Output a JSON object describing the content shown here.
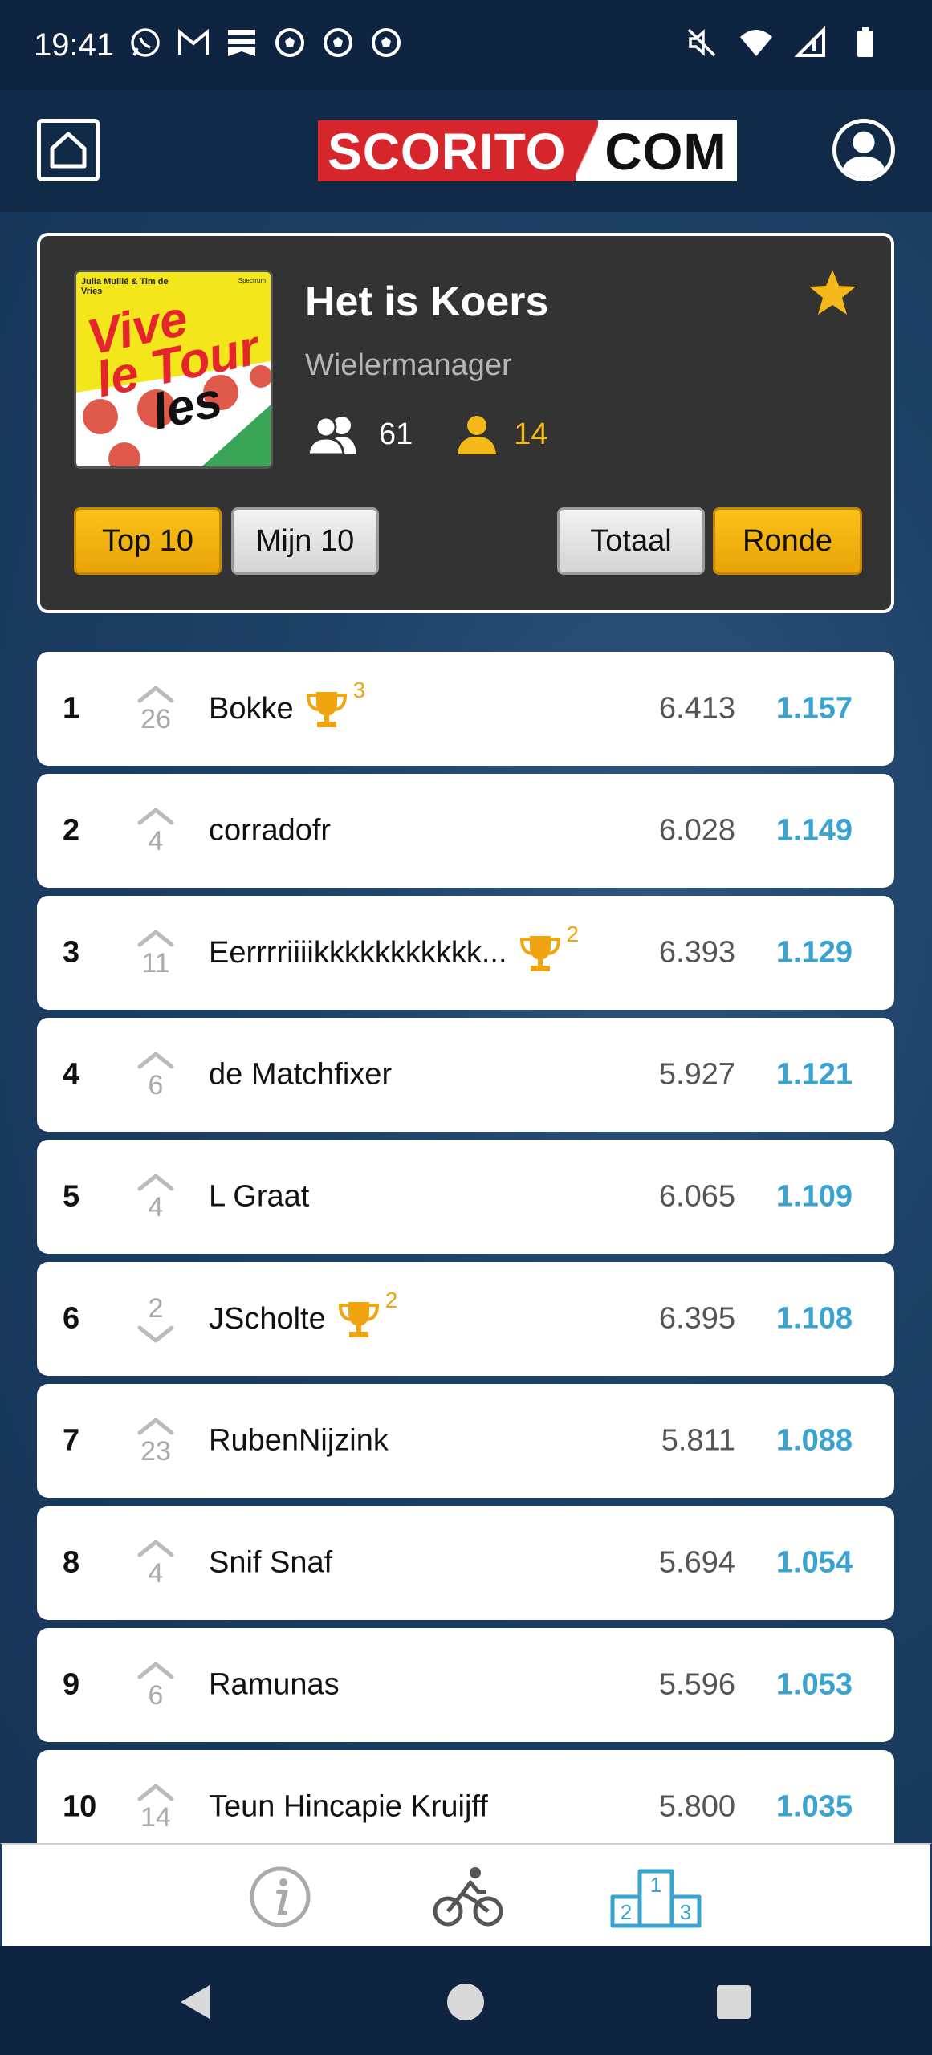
{
  "status_bar": {
    "time": "19:41",
    "left_icons": [
      "whatsapp-icon",
      "gmail-icon",
      "news-icon",
      "soccer-ball-icon",
      "soccer-ball-icon",
      "soccer-ball-icon"
    ],
    "right_icons": [
      "mute-icon",
      "wifi-icon",
      "signal-icon",
      "battery-icon"
    ]
  },
  "header": {
    "logo_left": "SCORITO",
    "logo_right": "COM"
  },
  "league": {
    "cover_author": "Julia Mullié & Tim de Vries",
    "cover_publisher": "Spectrum",
    "cover_title_line1": "Vive",
    "cover_title_line2": "le Tour",
    "cover_title_line3": "les",
    "title": "Het is Koers",
    "type": "Wielermanager",
    "members_count": "61",
    "my_count": "14"
  },
  "filters": {
    "top10": "Top 10",
    "mijn10": "Mijn 10",
    "totaal": "Totaal",
    "ronde": "Ronde"
  },
  "rows": [
    {
      "pos": "1",
      "dir": "up",
      "move": "26",
      "name": "Bokke",
      "trophies": "3",
      "total": "6.413",
      "round": "1.157"
    },
    {
      "pos": "2",
      "dir": "up",
      "move": "4",
      "name": "corradofr",
      "trophies": "",
      "total": "6.028",
      "round": "1.149"
    },
    {
      "pos": "3",
      "dir": "up",
      "move": "11",
      "name": "Eerrrriiiikkkkkkkkkkk...",
      "trophies": "2",
      "total": "6.393",
      "round": "1.129"
    },
    {
      "pos": "4",
      "dir": "up",
      "move": "6",
      "name": "de Matchfixer",
      "trophies": "",
      "total": "5.927",
      "round": "1.121"
    },
    {
      "pos": "5",
      "dir": "up",
      "move": "4",
      "name": "L Graat",
      "trophies": "",
      "total": "6.065",
      "round": "1.109"
    },
    {
      "pos": "6",
      "dir": "down",
      "move": "2",
      "name": "JScholte",
      "trophies": "2",
      "total": "6.395",
      "round": "1.108"
    },
    {
      "pos": "7",
      "dir": "up",
      "move": "23",
      "name": "RubenNijzink",
      "trophies": "",
      "total": "5.811",
      "round": "1.088"
    },
    {
      "pos": "8",
      "dir": "up",
      "move": "4",
      "name": "Snif Snaf",
      "trophies": "",
      "total": "5.694",
      "round": "1.054"
    },
    {
      "pos": "9",
      "dir": "up",
      "move": "6",
      "name": "Ramunas",
      "trophies": "",
      "total": "5.596",
      "round": "1.053"
    },
    {
      "pos": "10",
      "dir": "up",
      "move": "14",
      "name": "Teun Hincapie Kruijff",
      "trophies": "",
      "total": "5.800",
      "round": "1.035"
    }
  ],
  "tabbar": {
    "podium_numbers": [
      "1",
      "2",
      "3"
    ]
  },
  "colors": {
    "accent_yellow": "#f4b818",
    "round_blue": "#3aa3cf",
    "brand_red": "#d7262b",
    "dark_navy": "#0e2440"
  }
}
